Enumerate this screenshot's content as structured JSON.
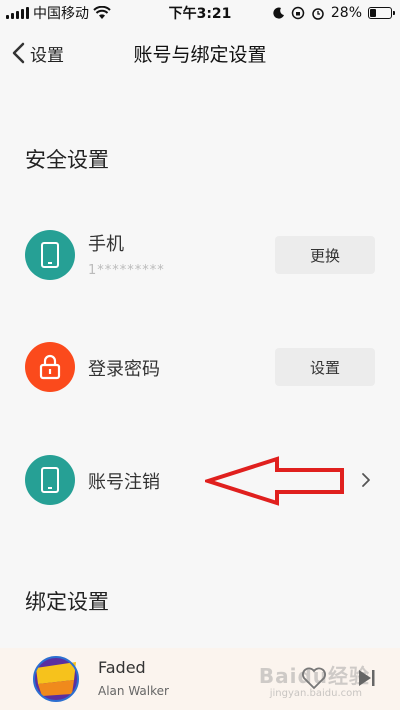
{
  "status_bar": {
    "carrier": "中国移动",
    "time": "下午3:21",
    "battery_percent": "28%",
    "battery_level": 0.28
  },
  "nav": {
    "back_label": "设置",
    "title": "账号与绑定设置"
  },
  "security": {
    "title": "安全设置",
    "rows": [
      {
        "label": "手机",
        "sub": "1*********",
        "button": "更换",
        "icon": "phone-icon",
        "color": "#26a095"
      },
      {
        "label": "登录密码",
        "button": "设置",
        "icon": "lock-icon",
        "color": "#fb4a1c"
      },
      {
        "label": "账号注销",
        "icon": "phone-icon",
        "color": "#26a095"
      }
    ]
  },
  "binding": {
    "title": "绑定设置"
  },
  "player": {
    "song": "Faded",
    "artist": "Alan Walker",
    "album_art": "now-fitness-cover"
  },
  "watermark": {
    "text": "Baidu经验",
    "sub": "jingyan.baidu.com"
  },
  "colors": {
    "teal": "#26a095",
    "orange": "#fb4a1c",
    "arrow": "#e0201e"
  }
}
